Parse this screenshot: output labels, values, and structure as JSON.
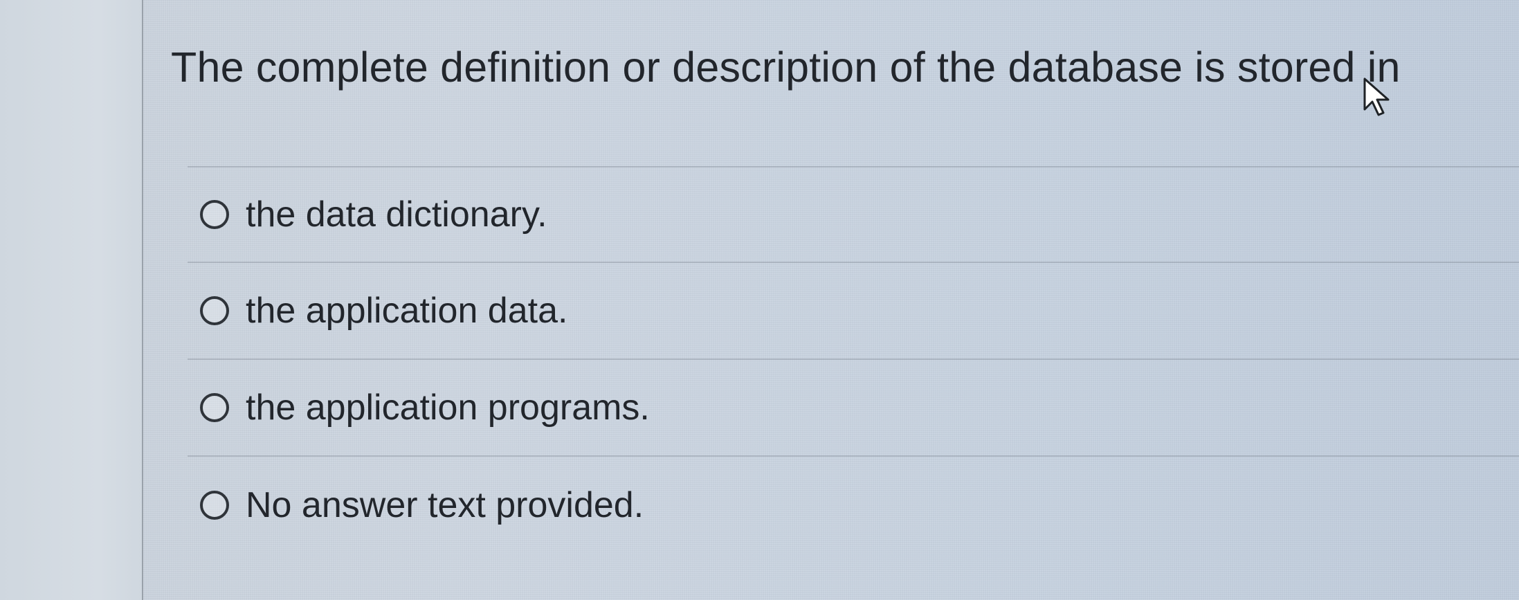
{
  "question": {
    "text": "The complete definition or description of the database is stored in"
  },
  "options": [
    {
      "label": "the data dictionary."
    },
    {
      "label": "the application data."
    },
    {
      "label": "the application programs."
    },
    {
      "label": "No answer text provided."
    }
  ],
  "icons": {
    "cursor": "mouse-pointer-icon",
    "radio": "radio-button-unselected-icon"
  },
  "colors": {
    "background": "#cbd5e1",
    "text": "#22262c",
    "divider": "#8a929a"
  }
}
